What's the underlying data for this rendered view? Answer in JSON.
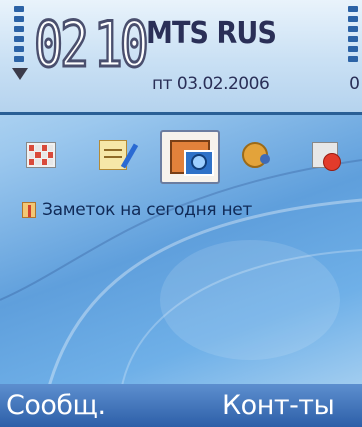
{
  "status": {
    "time_hours": "02",
    "time_minutes": "10",
    "operator": "MTS RUS",
    "date": "пт 03.02.2006",
    "date_trailing": "0"
  },
  "app_bar": {
    "icons": [
      {
        "name": "calendar-icon"
      },
      {
        "name": "notes-icon"
      },
      {
        "name": "gallery-icon",
        "selected": true
      },
      {
        "name": "settings-icon"
      },
      {
        "name": "tools-icon"
      }
    ]
  },
  "agenda": {
    "text": "Заметок на сегодня нет"
  },
  "softkeys": {
    "left": "Сообщ.",
    "right": "Конт-ты"
  },
  "colors": {
    "header_accent": "#2a5f95",
    "softkey_bar": "#2d5fa8",
    "text_dark": "#2a2f57"
  }
}
